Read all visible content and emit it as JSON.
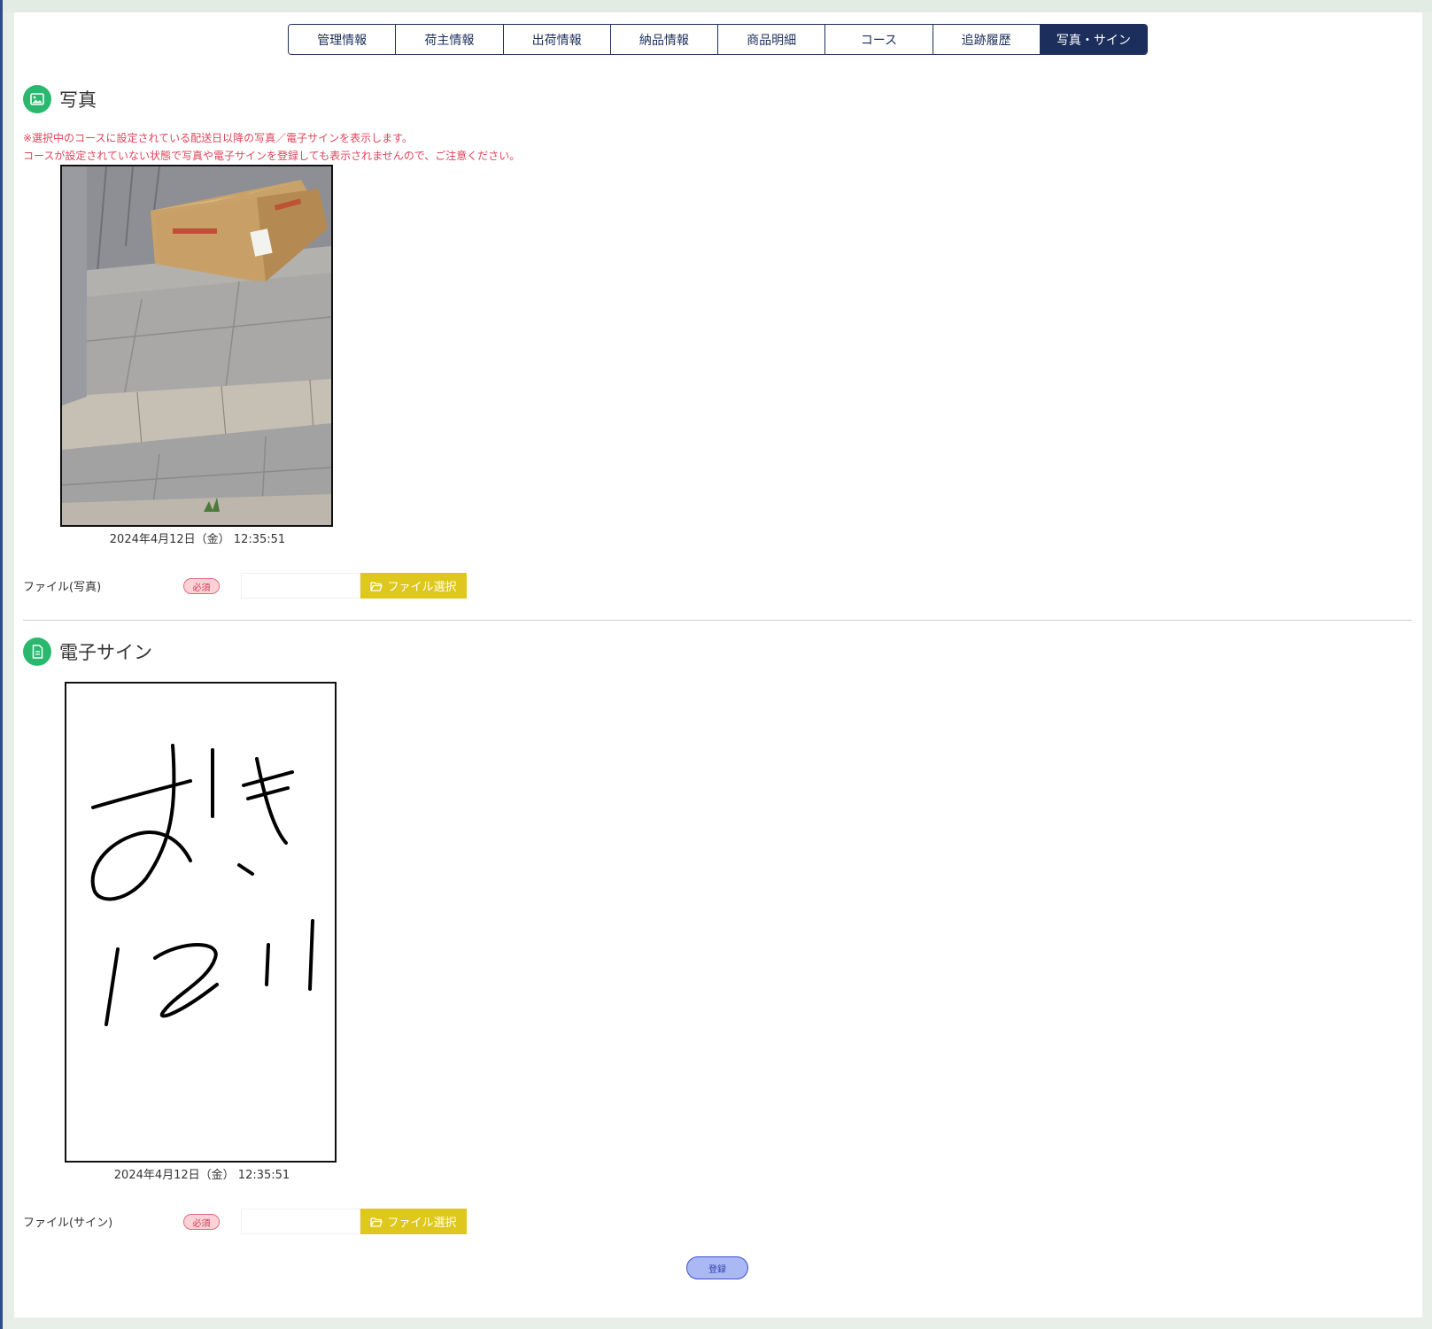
{
  "tabs": [
    {
      "label": "管理情報",
      "active": false
    },
    {
      "label": "荷主情報",
      "active": false
    },
    {
      "label": "出荷情報",
      "active": false
    },
    {
      "label": "納品情報",
      "active": false
    },
    {
      "label": "商品明細",
      "active": false
    },
    {
      "label": "コース",
      "active": false
    },
    {
      "label": "追跡履歴",
      "active": false
    },
    {
      "label": "写真・サイン",
      "active": true
    }
  ],
  "photo_section": {
    "title": "写真",
    "icon": "image-icon",
    "notice_lines": [
      "※選択中のコースに設定されている配送日以降の写真／電子サインを表示します。",
      "コースが設定されていない状態で写真や電子サインを登録しても表示されませんので、ご注意ください。"
    ],
    "timestamp": "2024年4月12日（金） 12:35:51",
    "file_label": "ファイル(写真)",
    "required_label": "必須",
    "file_input_value": "",
    "file_button_label": "ファイル選択"
  },
  "sign_section": {
    "title": "電子サイン",
    "icon": "document-icon",
    "timestamp": "2024年4月12日（金） 12:35:51",
    "file_label": "ファイル(サイン)",
    "required_label": "必須",
    "file_input_value": "",
    "file_button_label": "ファイル選択"
  },
  "submit_label": "登録",
  "colors": {
    "tab_active_bg": "#1c2f5c",
    "accent_green": "#29b86e",
    "notice_red": "#e0445a",
    "file_button_yellow": "#dfc81e",
    "submit_blue": "#aab8f4"
  }
}
